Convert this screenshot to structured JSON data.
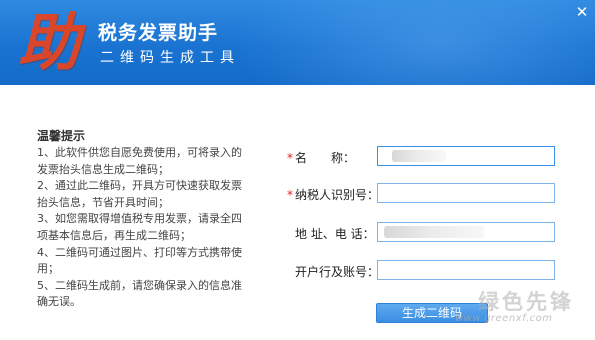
{
  "header": {
    "logo_char": "助",
    "title": "税务发票助手",
    "subtitle": "二维码生成工具"
  },
  "tips": {
    "title": "温馨提示",
    "items": [
      "1、此软件供您自愿免费使用，可将录入的发票抬头信息生成二维码；",
      "2、通过此二维码，开具方可快速获取发票抬头信息，节省开具时间；",
      "3、如您需取得增值税专用发票，请录全四项基本信息后，再生成二维码；",
      "4、二维码可通过图片、打印等方式携带使用；",
      "5、二维码生成前，请您确保录入的信息准确无误。"
    ]
  },
  "form": {
    "required_mark": "*",
    "name_label": "名　　称：",
    "name_value": "",
    "tax_id_label": "纳税人识别号：",
    "tax_id_value": "",
    "address_label": "地 址、电 话：",
    "address_value": "",
    "bank_label": "开户行及账号：",
    "bank_value": "",
    "generate_button": "生成二维码"
  },
  "watermark": {
    "brand": "绿色先锋",
    "url": "www.greenxf.com"
  },
  "close_glyph": "✕"
}
